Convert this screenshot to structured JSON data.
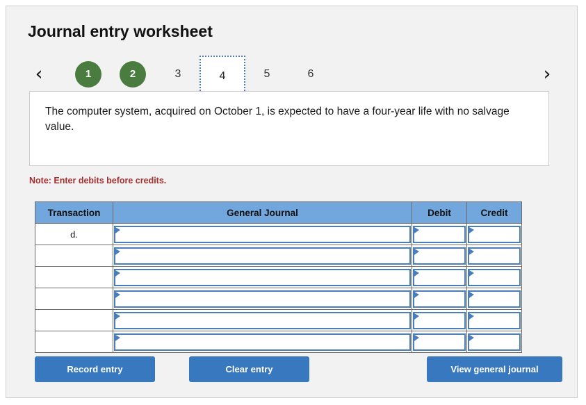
{
  "page": {
    "title": "Journal entry worksheet"
  },
  "navigation": {
    "prev_icon": "‹",
    "next_icon": "›",
    "steps": [
      {
        "label": "1",
        "state": "done"
      },
      {
        "label": "2",
        "state": "done"
      },
      {
        "label": "3",
        "state": "normal"
      },
      {
        "label": "4",
        "state": "current"
      },
      {
        "label": "5",
        "state": "normal"
      },
      {
        "label": "6",
        "state": "normal"
      }
    ]
  },
  "prompt": {
    "text": "The computer system, acquired on October 1, is expected to have a four-year life with no salvage value."
  },
  "note": {
    "text": "Note: Enter debits before credits."
  },
  "table": {
    "headers": {
      "transaction": "Transaction",
      "general_journal": "General Journal",
      "debit": "Debit",
      "credit": "Credit"
    },
    "rows": [
      {
        "transaction": "d.",
        "account": "",
        "debit": "",
        "credit": ""
      },
      {
        "transaction": "",
        "account": "",
        "debit": "",
        "credit": ""
      },
      {
        "transaction": "",
        "account": "",
        "debit": "",
        "credit": ""
      },
      {
        "transaction": "",
        "account": "",
        "debit": "",
        "credit": ""
      },
      {
        "transaction": "",
        "account": "",
        "debit": "",
        "credit": ""
      },
      {
        "transaction": "",
        "account": "",
        "debit": "",
        "credit": ""
      }
    ]
  },
  "actions": {
    "record": "Record entry",
    "clear": "Clear entry",
    "view": "View general journal"
  },
  "colors": {
    "panel_background": "#f2f2f2",
    "header_blue": "#72a7dd",
    "button_blue": "#3878be",
    "step_done_green": "#4a7c3f",
    "note_red": "#a33030",
    "field_border_blue": "#4a7ebb"
  }
}
